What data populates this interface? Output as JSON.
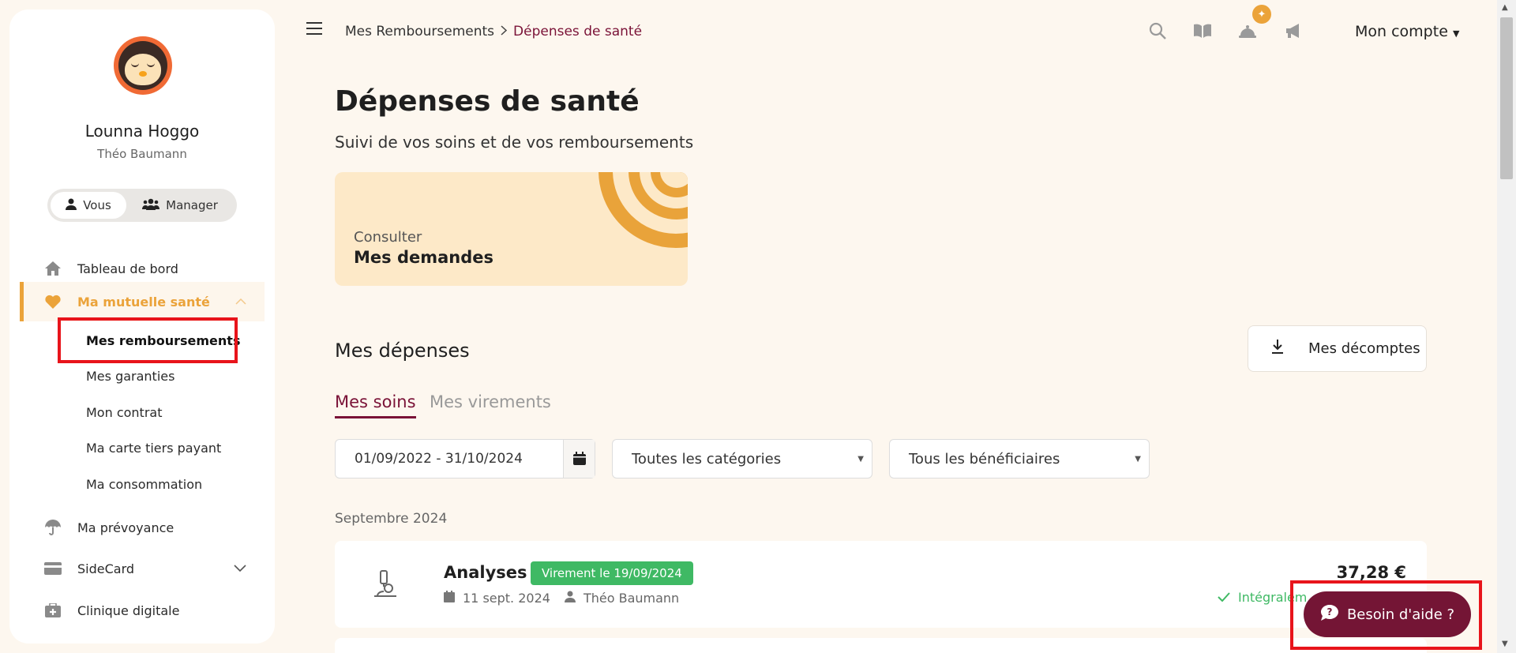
{
  "sidebar": {
    "user_name": "Lounna Hoggo",
    "user_sub": "Théo Baumann",
    "toggle": {
      "you": "Vous",
      "manager": "Manager"
    },
    "nav": {
      "dashboard": "Tableau de bord",
      "mutuelle": "Ma mutuelle santé",
      "prevoyance": "Ma prévoyance",
      "sidecard": "SideCard",
      "clinique": "Clinique digitale"
    },
    "sub": {
      "remboursements": "Mes remboursements",
      "garanties": "Mes garanties",
      "contrat": "Mon contrat",
      "carte": "Ma carte tiers payant",
      "consommation": "Ma consommation"
    }
  },
  "topbar": {
    "breadcrumb_parent": "Mes Remboursements",
    "breadcrumb_current": "Dépenses de santé",
    "account": "Mon compte"
  },
  "main": {
    "title": "Dépenses de santé",
    "subtitle": "Suivi de vos soins et de vos remboursements",
    "card": {
      "label1": "Consulter",
      "label2": "Mes demandes"
    },
    "section_title": "Mes dépenses",
    "decomptes": "Mes décomptes",
    "tabs": {
      "soins": "Mes soins",
      "virements": "Mes virements"
    },
    "filters": {
      "date_range": "01/09/2022 - 31/10/2024",
      "categories": "Toutes les catégories",
      "beneficiaires": "Tous les bénéficiaires"
    },
    "month": "Septembre 2024",
    "row": {
      "title": "Analyses",
      "badge": "Virement le 19/09/2024",
      "date": "11 sept. 2024",
      "person": "Théo Baumann",
      "amount": "37,28 €",
      "status": "Intégralem"
    }
  },
  "help": "Besoin d'aide ?",
  "colors": {
    "accent": "#eba33a",
    "brand": "#741535",
    "success": "#3fb964",
    "highlight": "#e8141b"
  }
}
